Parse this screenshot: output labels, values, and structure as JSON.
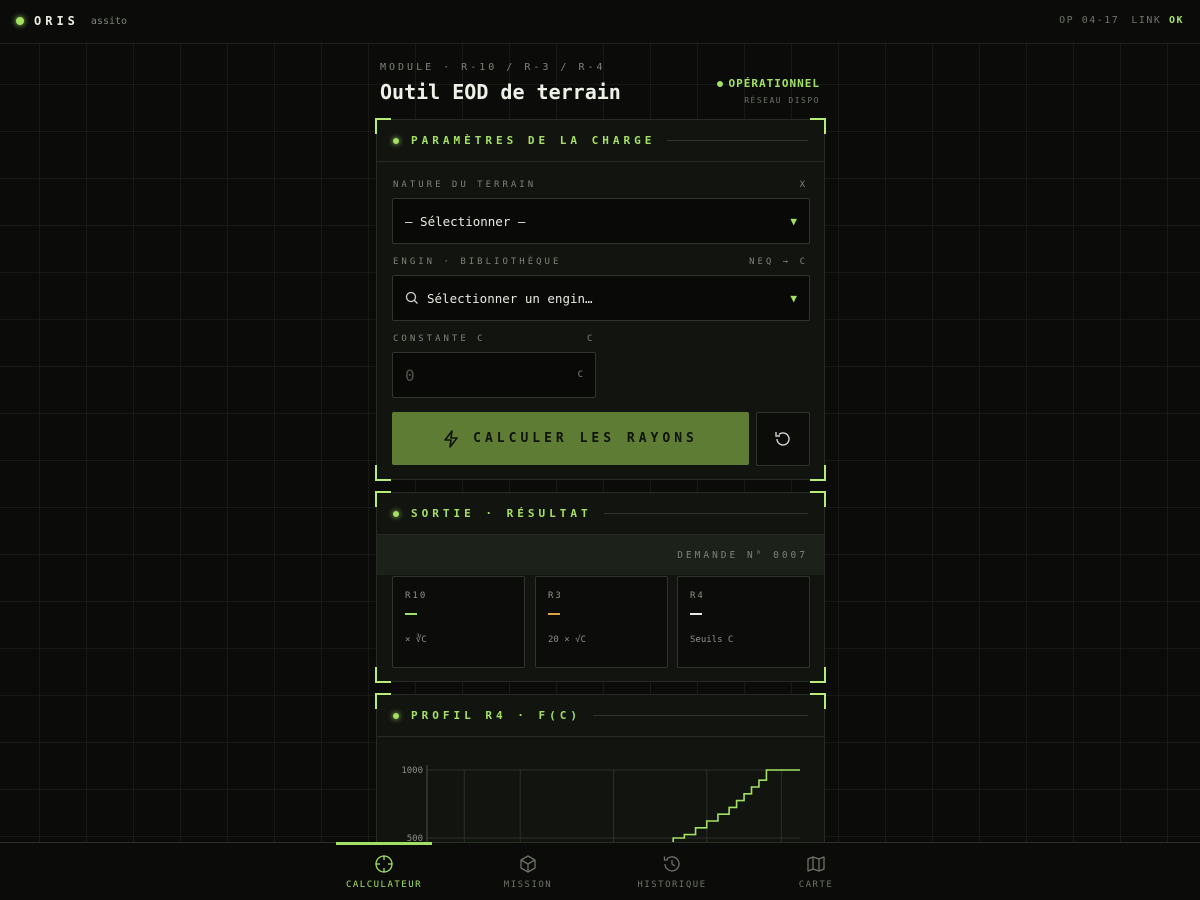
{
  "app": {
    "name": "ORIS",
    "subtitle": "assito"
  },
  "topbar": {
    "op": "OP 04-17",
    "link_label": "LINK",
    "link_status": "OK"
  },
  "header": {
    "breadcrumb": "MODULE · R-10 / R-3 / R-4",
    "title": "Outil EOD de terrain",
    "status": "OPÉRATIONNEL",
    "status_sub": "RÉSEAU DISPO"
  },
  "params": {
    "title": "PARAMÈTRES DE LA CHARGE",
    "terrain": {
      "label": "NATURE DU TERRAIN",
      "hint": "X",
      "value": "— Sélectionner —"
    },
    "engin": {
      "label": "ENGIN · BIBLIOTHÈQUE",
      "hint": "NEQ → C",
      "value": "Sélectionner un engin…"
    },
    "constante": {
      "label": "CONSTANTE C",
      "hint": "C",
      "value": "0",
      "unit": "C"
    },
    "calc_label": "CALCULER LES RAYONS"
  },
  "output": {
    "title": "SORTIE · RÉSULTAT",
    "request": "DEMANDE N° 0007",
    "cards": [
      {
        "name": "R10",
        "formula": "× ∛C",
        "color": "#a4e063"
      },
      {
        "name": "R3",
        "formula": "20 × √C",
        "color": "#d9a441"
      },
      {
        "name": "R4",
        "formula": "Seuils C",
        "color": "#e6e9df"
      }
    ]
  },
  "profile": {
    "title": "PROFIL R4 · F(C)"
  },
  "chart_data": {
    "type": "line",
    "title": "PROFIL R4 · F(C)",
    "ylabel": "",
    "xlabel": "",
    "y_ticks": [
      500,
      1000
    ],
    "ylim": [
      0,
      1100
    ],
    "xlim": [
      0,
      100
    ],
    "series": [
      {
        "x": [
          0,
          66,
          66,
          69,
          69,
          72,
          72,
          75,
          75,
          78,
          78,
          81,
          81,
          83,
          83,
          85,
          85,
          87,
          87,
          89,
          89,
          91,
          91,
          100
        ],
        "y": [
          0,
          0,
          500,
          500,
          525,
          525,
          575,
          575,
          625,
          625,
          675,
          675,
          725,
          725,
          775,
          775,
          825,
          825,
          875,
          875,
          925,
          925,
          1000,
          1000
        ]
      }
    ],
    "grid": true,
    "color": "#a4e063"
  },
  "nav": [
    {
      "label": "CALCULATEUR",
      "icon": "crosshair-icon",
      "active": true
    },
    {
      "label": "MISSION",
      "icon": "package-icon",
      "active": false
    },
    {
      "label": "HISTORIQUE",
      "icon": "history-icon",
      "active": false
    },
    {
      "label": "CARTE",
      "icon": "map-icon",
      "active": false
    }
  ]
}
